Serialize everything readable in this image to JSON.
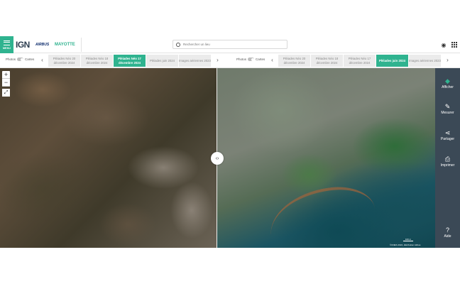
{
  "header": {
    "menu_label": "MENU",
    "logo_ign": "IGN",
    "logo_airbus": "AIRBUS",
    "logo_mayotte": "MAYOTTE",
    "search_placeholder": "Rechercher un lieu"
  },
  "timeline_left": {
    "toggle_photos": "Photos",
    "toggle_cartes": "Cartes",
    "tabs": [
      {
        "label": "Pléiades Néo 20 décembre 2024",
        "active": false
      },
      {
        "label": "Pléiades Néo 18 décembre 2024",
        "active": false
      },
      {
        "label": "Pléiades Néo 17 décembre 2024",
        "active": true
      },
      {
        "label": "Pléiades juin 2024",
        "active": false
      },
      {
        "label": "Images aériennes 2023",
        "active": false
      }
    ]
  },
  "timeline_right": {
    "toggle_photos": "Photos",
    "toggle_cartes": "Cartes",
    "tabs": [
      {
        "label": "Pléiades Néo 20 décembre 2024",
        "active": false
      },
      {
        "label": "Pléiades Néo 18 décembre 2024",
        "active": false
      },
      {
        "label": "Pléiades Néo 17 décembre 2024",
        "active": false
      },
      {
        "label": "Pléiades juin 2024",
        "active": true
      },
      {
        "label": "Images aériennes 2023",
        "active": false
      }
    ]
  },
  "map": {
    "zoom_in": "+",
    "zoom_out": "−",
    "fullscreen": "⤢",
    "compare_handle": "‹›",
    "scale_label": "100 m",
    "attribution": "©CNES 2024, distribution Airbus"
  },
  "right_panel": {
    "items": [
      {
        "label": "Afficher",
        "icon": "layers-icon",
        "glyph": "◆"
      },
      {
        "label": "Mesurer",
        "icon": "ruler-icon",
        "glyph": "✎"
      },
      {
        "label": "Partager",
        "icon": "share-icon",
        "glyph": "⋖"
      },
      {
        "label": "Imprimer",
        "icon": "print-icon",
        "glyph": "⎙"
      },
      {
        "label": "Aide",
        "icon": "help-icon",
        "glyph": "?"
      }
    ]
  },
  "colors": {
    "accent": "#2fb38f",
    "panel": "#3b4956"
  }
}
